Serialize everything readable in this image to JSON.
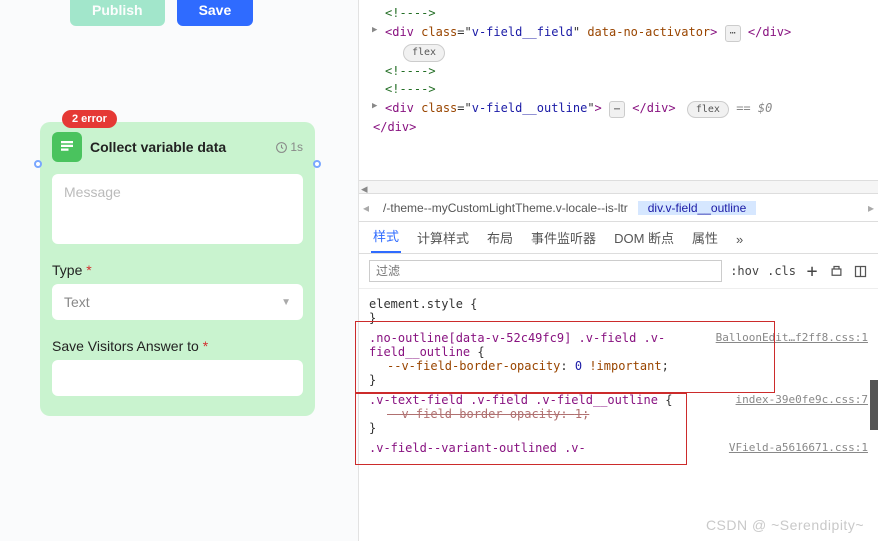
{
  "buttons": {
    "publish": "Publish",
    "save": "Save"
  },
  "card": {
    "error_badge": "2 error",
    "title": "Collect variable data",
    "timing": "1s",
    "message_placeholder": "Message",
    "type_label": "Type",
    "type_value": "Text",
    "save_label": "Save Visitors Answer to"
  },
  "required": "*",
  "dom": {
    "comment": "<!---->",
    "div1_open": "<div class=\"v-field__field\" data-no-activator>",
    "div1_close": "</div>",
    "flex_chip": "flex",
    "div2_open": "<div class=\"v-field__outline\">",
    "div2_close": "</div>",
    "eq0": "== $0",
    "close_div": "</div>",
    "ellipsis": "⋯"
  },
  "crumbs": {
    "a": "/-theme--myCustomLightTheme.v-locale--is-ltr",
    "b": "div.v-field__outline"
  },
  "tabs": {
    "t1": "样式",
    "t2": "计算样式",
    "t3": "布局",
    "t4": "事件监听器",
    "t5": "DOM 断点",
    "t6": "属性",
    "more": "»"
  },
  "filter": {
    "placeholder": "过滤",
    "hov": ":hov",
    "cls": ".cls"
  },
  "styles": {
    "element_style": "element.style {",
    "close_brace": "}",
    "rule1_sel": ".no-outline[data-v-52c49fc9] .v-field .v-field__outline {",
    "rule1_prop": "--v-field-border-opacity",
    "rule1_val": "0 !important",
    "rule1_src": "BalloonEdit…f2ff8.css:1",
    "rule2_sel": ".v-text-field .v-field .v-field__outline {",
    "rule2_prop": "--v-field-border-opacity",
    "rule2_val": "1",
    "rule2_src": "index-39e0fe9c.css:7",
    "rule3_sel": ".v-field--variant-outlined .v-",
    "rule3_src": "VField-a5616671.css:1"
  },
  "watermark": "CSDN @ ~Serendipity~"
}
